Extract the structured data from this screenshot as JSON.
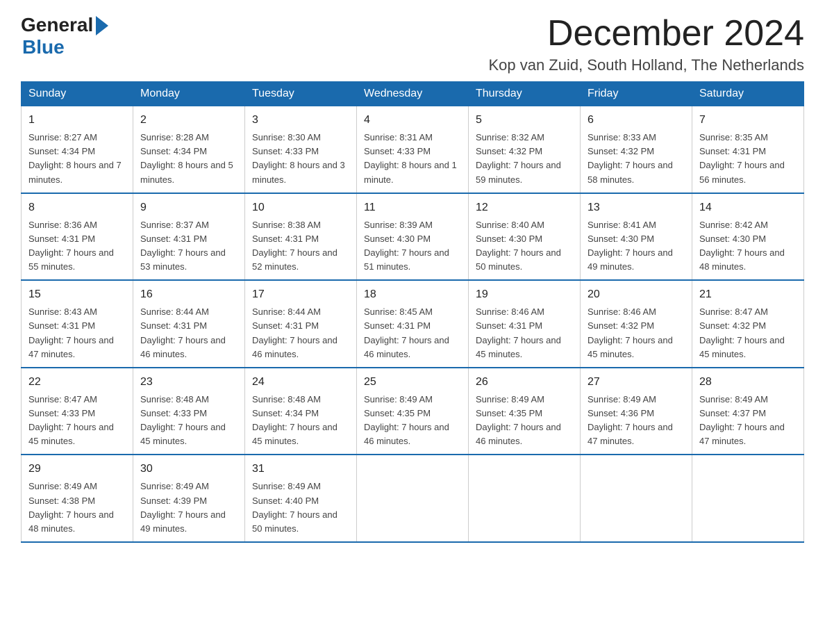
{
  "logo": {
    "general": "General",
    "blue": "Blue"
  },
  "title": "December 2024",
  "subtitle": "Kop van Zuid, South Holland, The Netherlands",
  "days_header": [
    "Sunday",
    "Monday",
    "Tuesday",
    "Wednesday",
    "Thursday",
    "Friday",
    "Saturday"
  ],
  "weeks": [
    [
      {
        "num": "1",
        "sunrise": "8:27 AM",
        "sunset": "4:34 PM",
        "daylight": "8 hours and 7 minutes."
      },
      {
        "num": "2",
        "sunrise": "8:28 AM",
        "sunset": "4:34 PM",
        "daylight": "8 hours and 5 minutes."
      },
      {
        "num": "3",
        "sunrise": "8:30 AM",
        "sunset": "4:33 PM",
        "daylight": "8 hours and 3 minutes."
      },
      {
        "num": "4",
        "sunrise": "8:31 AM",
        "sunset": "4:33 PM",
        "daylight": "8 hours and 1 minute."
      },
      {
        "num": "5",
        "sunrise": "8:32 AM",
        "sunset": "4:32 PM",
        "daylight": "7 hours and 59 minutes."
      },
      {
        "num": "6",
        "sunrise": "8:33 AM",
        "sunset": "4:32 PM",
        "daylight": "7 hours and 58 minutes."
      },
      {
        "num": "7",
        "sunrise": "8:35 AM",
        "sunset": "4:31 PM",
        "daylight": "7 hours and 56 minutes."
      }
    ],
    [
      {
        "num": "8",
        "sunrise": "8:36 AM",
        "sunset": "4:31 PM",
        "daylight": "7 hours and 55 minutes."
      },
      {
        "num": "9",
        "sunrise": "8:37 AM",
        "sunset": "4:31 PM",
        "daylight": "7 hours and 53 minutes."
      },
      {
        "num": "10",
        "sunrise": "8:38 AM",
        "sunset": "4:31 PM",
        "daylight": "7 hours and 52 minutes."
      },
      {
        "num": "11",
        "sunrise": "8:39 AM",
        "sunset": "4:30 PM",
        "daylight": "7 hours and 51 minutes."
      },
      {
        "num": "12",
        "sunrise": "8:40 AM",
        "sunset": "4:30 PM",
        "daylight": "7 hours and 50 minutes."
      },
      {
        "num": "13",
        "sunrise": "8:41 AM",
        "sunset": "4:30 PM",
        "daylight": "7 hours and 49 minutes."
      },
      {
        "num": "14",
        "sunrise": "8:42 AM",
        "sunset": "4:30 PM",
        "daylight": "7 hours and 48 minutes."
      }
    ],
    [
      {
        "num": "15",
        "sunrise": "8:43 AM",
        "sunset": "4:31 PM",
        "daylight": "7 hours and 47 minutes."
      },
      {
        "num": "16",
        "sunrise": "8:44 AM",
        "sunset": "4:31 PM",
        "daylight": "7 hours and 46 minutes."
      },
      {
        "num": "17",
        "sunrise": "8:44 AM",
        "sunset": "4:31 PM",
        "daylight": "7 hours and 46 minutes."
      },
      {
        "num": "18",
        "sunrise": "8:45 AM",
        "sunset": "4:31 PM",
        "daylight": "7 hours and 46 minutes."
      },
      {
        "num": "19",
        "sunrise": "8:46 AM",
        "sunset": "4:31 PM",
        "daylight": "7 hours and 45 minutes."
      },
      {
        "num": "20",
        "sunrise": "8:46 AM",
        "sunset": "4:32 PM",
        "daylight": "7 hours and 45 minutes."
      },
      {
        "num": "21",
        "sunrise": "8:47 AM",
        "sunset": "4:32 PM",
        "daylight": "7 hours and 45 minutes."
      }
    ],
    [
      {
        "num": "22",
        "sunrise": "8:47 AM",
        "sunset": "4:33 PM",
        "daylight": "7 hours and 45 minutes."
      },
      {
        "num": "23",
        "sunrise": "8:48 AM",
        "sunset": "4:33 PM",
        "daylight": "7 hours and 45 minutes."
      },
      {
        "num": "24",
        "sunrise": "8:48 AM",
        "sunset": "4:34 PM",
        "daylight": "7 hours and 45 minutes."
      },
      {
        "num": "25",
        "sunrise": "8:49 AM",
        "sunset": "4:35 PM",
        "daylight": "7 hours and 46 minutes."
      },
      {
        "num": "26",
        "sunrise": "8:49 AM",
        "sunset": "4:35 PM",
        "daylight": "7 hours and 46 minutes."
      },
      {
        "num": "27",
        "sunrise": "8:49 AM",
        "sunset": "4:36 PM",
        "daylight": "7 hours and 47 minutes."
      },
      {
        "num": "28",
        "sunrise": "8:49 AM",
        "sunset": "4:37 PM",
        "daylight": "7 hours and 47 minutes."
      }
    ],
    [
      {
        "num": "29",
        "sunrise": "8:49 AM",
        "sunset": "4:38 PM",
        "daylight": "7 hours and 48 minutes."
      },
      {
        "num": "30",
        "sunrise": "8:49 AM",
        "sunset": "4:39 PM",
        "daylight": "7 hours and 49 minutes."
      },
      {
        "num": "31",
        "sunrise": "8:49 AM",
        "sunset": "4:40 PM",
        "daylight": "7 hours and 50 minutes."
      },
      null,
      null,
      null,
      null
    ]
  ]
}
